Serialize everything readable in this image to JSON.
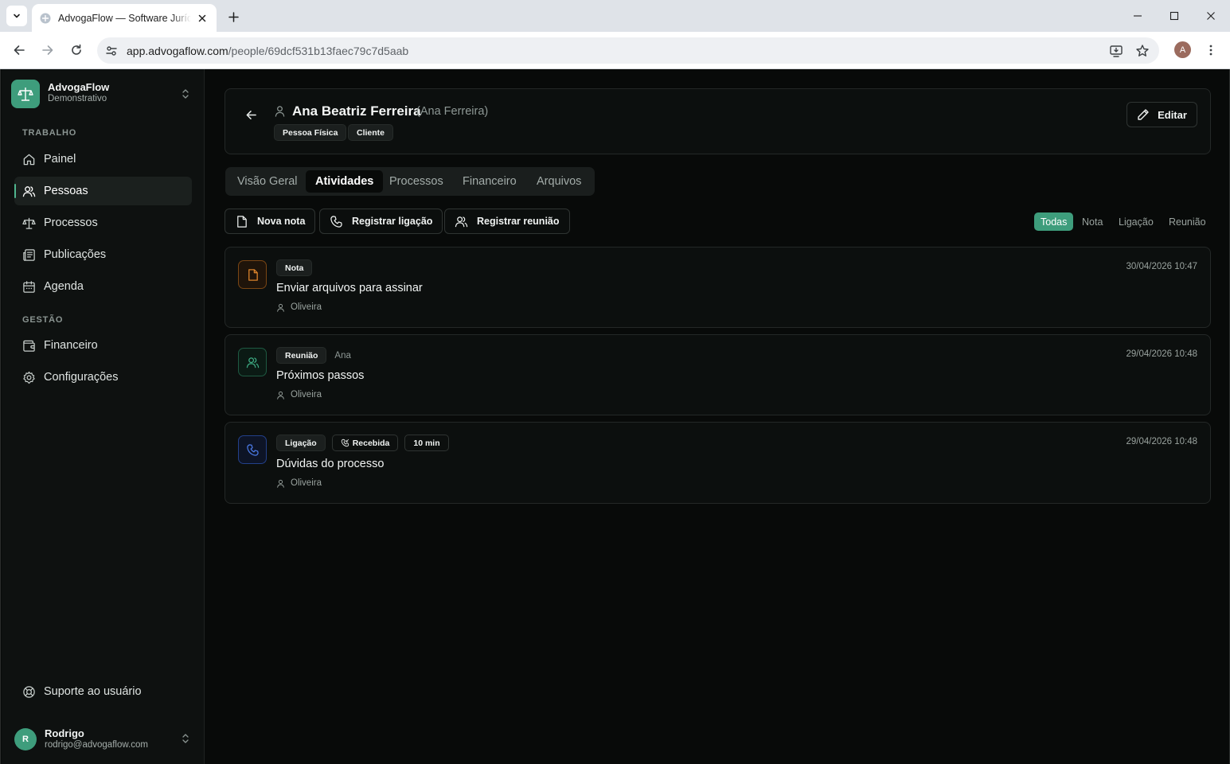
{
  "browser": {
    "tab_title": "AdvogaFlow — Software Jurídico",
    "url_host": "app.advogaflow.com",
    "url_path": "/people/69dcf531b13faec79c7d5aab",
    "profile_initial": "A"
  },
  "brand": {
    "name": "AdvogaFlow",
    "subtitle": "Demonstrativo",
    "accent": "#3e9d7c"
  },
  "sidebar": {
    "sections": [
      {
        "title": "TRABALHO",
        "items": [
          {
            "label": "Painel",
            "icon": "home-icon"
          },
          {
            "label": "Pessoas",
            "icon": "users-icon",
            "active": true
          },
          {
            "label": "Processos",
            "icon": "scale-icon"
          },
          {
            "label": "Publicações",
            "icon": "newspaper-icon"
          },
          {
            "label": "Agenda",
            "icon": "calendar-icon"
          }
        ]
      },
      {
        "title": "GESTÃO",
        "items": [
          {
            "label": "Financeiro",
            "icon": "wallet-icon"
          },
          {
            "label": "Configurações",
            "icon": "gear-icon"
          }
        ]
      }
    ],
    "support_label": "Suporte ao usuário",
    "user": {
      "initial": "R",
      "name": "Rodrigo",
      "email": "rodrigo@advogaflow.com"
    }
  },
  "person": {
    "name": "Ana Beatriz Ferreira",
    "alias": "(Ana Ferreira)",
    "tags": [
      "Pessoa Física",
      "Cliente"
    ],
    "edit_label": "Editar"
  },
  "tabs": [
    "Visão Geral",
    "Atividades",
    "Processos",
    "Financeiro",
    "Arquivos"
  ],
  "active_tab": "Atividades",
  "actions": {
    "new_note": "Nova nota",
    "log_call": "Registrar ligação",
    "log_meeting": "Registrar reunião"
  },
  "filters": [
    "Todas",
    "Nota",
    "Ligação",
    "Reunião"
  ],
  "active_filter": "Todas",
  "activities": [
    {
      "type": "Nota",
      "icon": "file-icon",
      "color": "#d9822b",
      "title": "Enviar arquivos para assinar",
      "author": "Oliveira",
      "date": "30/04/2026 10:47"
    },
    {
      "type": "Reunião",
      "icon": "users-icon",
      "color": "#3fae85",
      "participant": "Ana",
      "title": "Próximos passos",
      "author": "Oliveira",
      "date": "29/04/2026 10:48"
    },
    {
      "type": "Ligação",
      "icon": "phone-icon",
      "color": "#4b7be8",
      "direction": "Recebida",
      "duration": "10 min",
      "title": "Dúvidas do processo",
      "author": "Oliveira",
      "date": "29/04/2026 10:48"
    }
  ]
}
